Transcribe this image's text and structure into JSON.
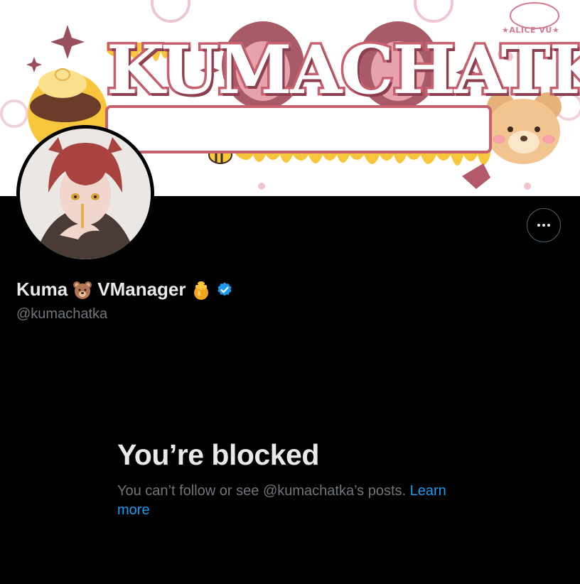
{
  "banner": {
    "title": "KUMACHATKA",
    "badge": "★ALICE VU★"
  },
  "profile": {
    "name_part1": "Kuma",
    "name_part2": "VManager",
    "handle": "@kumachatka",
    "emoji_after_kuma": "bear-face-icon",
    "emoji_after_name": "honey-pot-icon",
    "verified": "verified-badge-icon"
  },
  "actions": {
    "more_icon": "more-options-icon"
  },
  "blocked": {
    "title": "You’re blocked",
    "message": "You can’t follow or see @kumachatka’s posts.",
    "link_label": "Learn more"
  },
  "colors": {
    "background": "#000000",
    "primary_text": "#e7e9ea",
    "secondary_text": "#71767b",
    "link": "#1d9bf0",
    "verified": "#1d9bf0",
    "banner_accent": "#c7606e",
    "honey": "#f7c63a"
  }
}
